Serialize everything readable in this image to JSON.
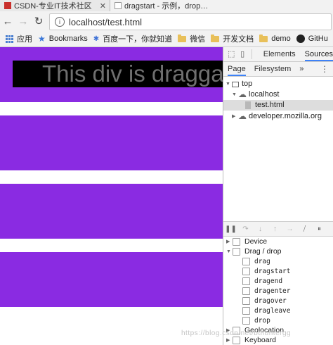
{
  "tabs": [
    {
      "title": "CSDN-专业IT技术社区",
      "active": false
    },
    {
      "title": "dragstart - 示例，drop…",
      "active": true
    }
  ],
  "toolbar": {
    "back_icon": "back-arrow-icon",
    "forward_icon": "forward-arrow-icon",
    "reload_icon": "reload-icon",
    "url": "localhost/test.html"
  },
  "bookmarks": [
    {
      "label": "应用",
      "icon": "apps-icon"
    },
    {
      "label": "Bookmarks",
      "icon": "star-icon"
    },
    {
      "label": "百度一下，你就知道",
      "icon": "paw-icon"
    },
    {
      "label": "微信",
      "icon": "folder-icon"
    },
    {
      "label": "开发文档",
      "icon": "folder-icon"
    },
    {
      "label": "demo",
      "icon": "folder-icon"
    },
    {
      "label": "GitHu",
      "icon": "github-icon"
    }
  ],
  "page": {
    "drag_text": "This div is dragga",
    "band_color": "#8a2be2"
  },
  "devtools": {
    "main_tabs": [
      "Elements",
      "Sources"
    ],
    "active_main_tab": "Sources",
    "nav_tabs": [
      "Page",
      "Filesystem"
    ],
    "more": "»",
    "tree": {
      "top": "top",
      "host": "localhost",
      "file": "test.html",
      "other": "developer.mozilla.org"
    },
    "breakpoint_groups": [
      {
        "label": "Device",
        "expanded": false
      },
      {
        "label": "Drag / drop",
        "expanded": true
      }
    ],
    "drag_events": [
      "drag",
      "dragstart",
      "dragend",
      "dragenter",
      "dragover",
      "dragleave",
      "drop"
    ],
    "later_groups": [
      {
        "label": "Geolocation",
        "expanded": false
      },
      {
        "label": "Keyboard",
        "expanded": false
      }
    ]
  },
  "watermark": "https://blog.csdn.net/bthuntergg"
}
